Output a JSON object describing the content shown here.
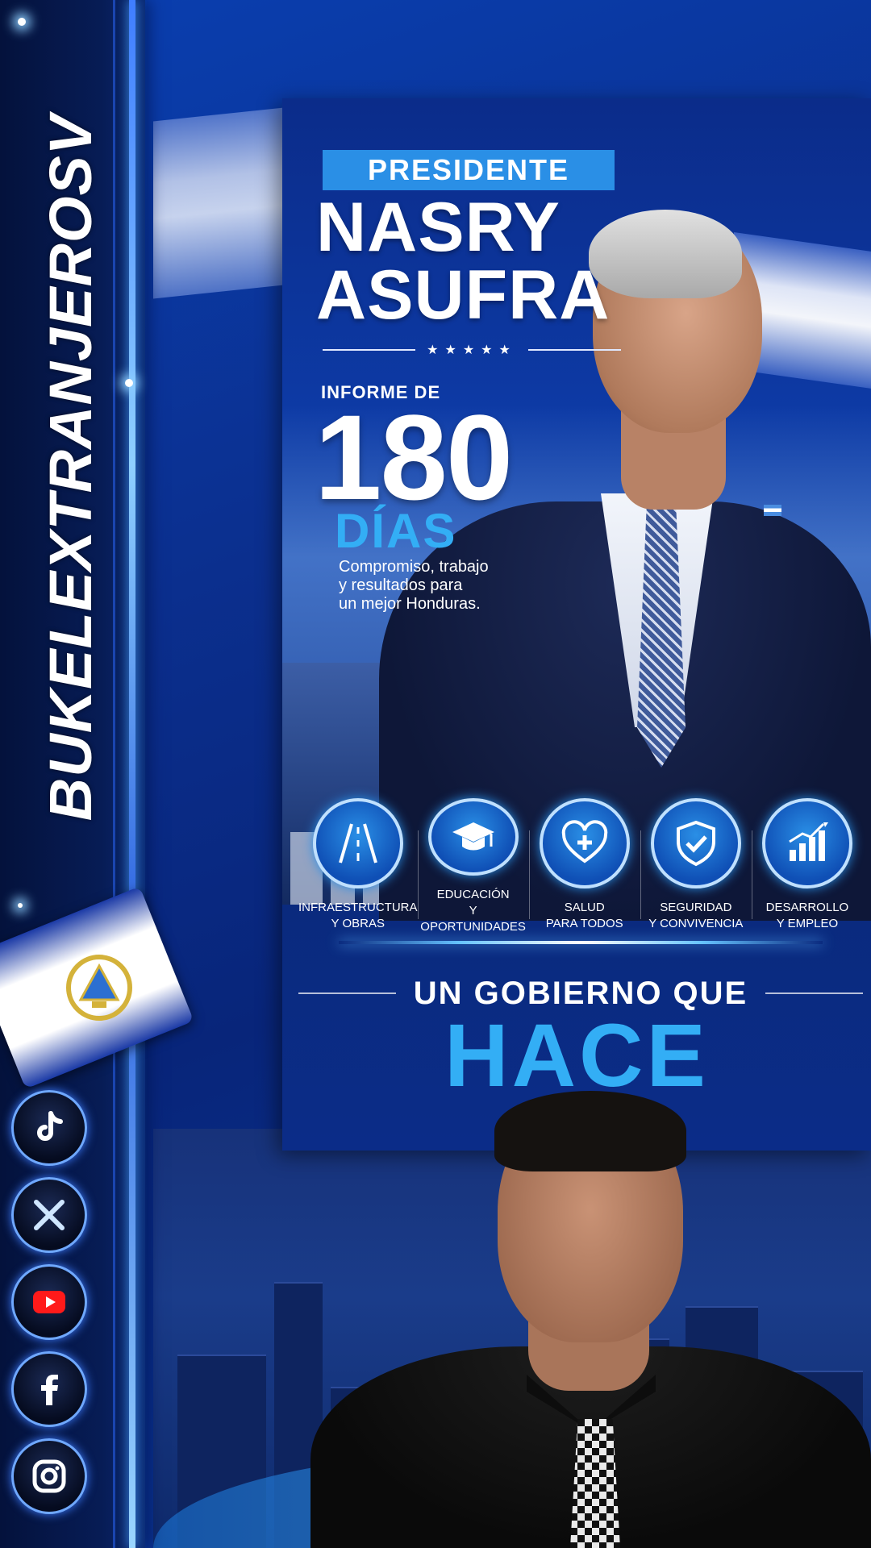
{
  "sidebar": {
    "channel_name": "BUKELEXTRANJEROSV",
    "social_icons": [
      "tiktok-icon",
      "x-icon",
      "youtube-icon",
      "facebook-icon",
      "instagram-icon"
    ]
  },
  "poster": {
    "badge": "PRESIDENTE",
    "name_line1": "NASRY",
    "name_line2": "ASUFRA",
    "stars": "★★★★★",
    "informe_label": "INFORME DE",
    "number": "180",
    "days": "DÍAS",
    "tagline_line1": "Compromiso, trabajo",
    "tagline_line2": "y resultados para",
    "tagline_line3": "un mejor Honduras.",
    "pillars": [
      {
        "icon": "road-icon",
        "line1": "INFRAESTRUCTURA",
        "line2": "Y OBRAS"
      },
      {
        "icon": "graduation-cap-icon",
        "line1": "EDUCACIÓN",
        "line2": "Y OPORTUNIDADES"
      },
      {
        "icon": "heart-medical-icon",
        "line1": "SALUD",
        "line2": "PARA TODOS"
      },
      {
        "icon": "shield-check-icon",
        "line1": "SEGURIDAD",
        "line2": "Y CONVIVENCIA"
      },
      {
        "icon": "growth-chart-icon",
        "line1": "DESARROLLO",
        "line2": "Y EMPLEO"
      }
    ],
    "slogan_line1": "UN GOBIERNO QUE",
    "slogan_line2": "HACE"
  },
  "colors": {
    "accent_light_blue": "#33aef5",
    "badge_blue": "#2a8fe6",
    "background_navy": "#0b2c8a"
  }
}
